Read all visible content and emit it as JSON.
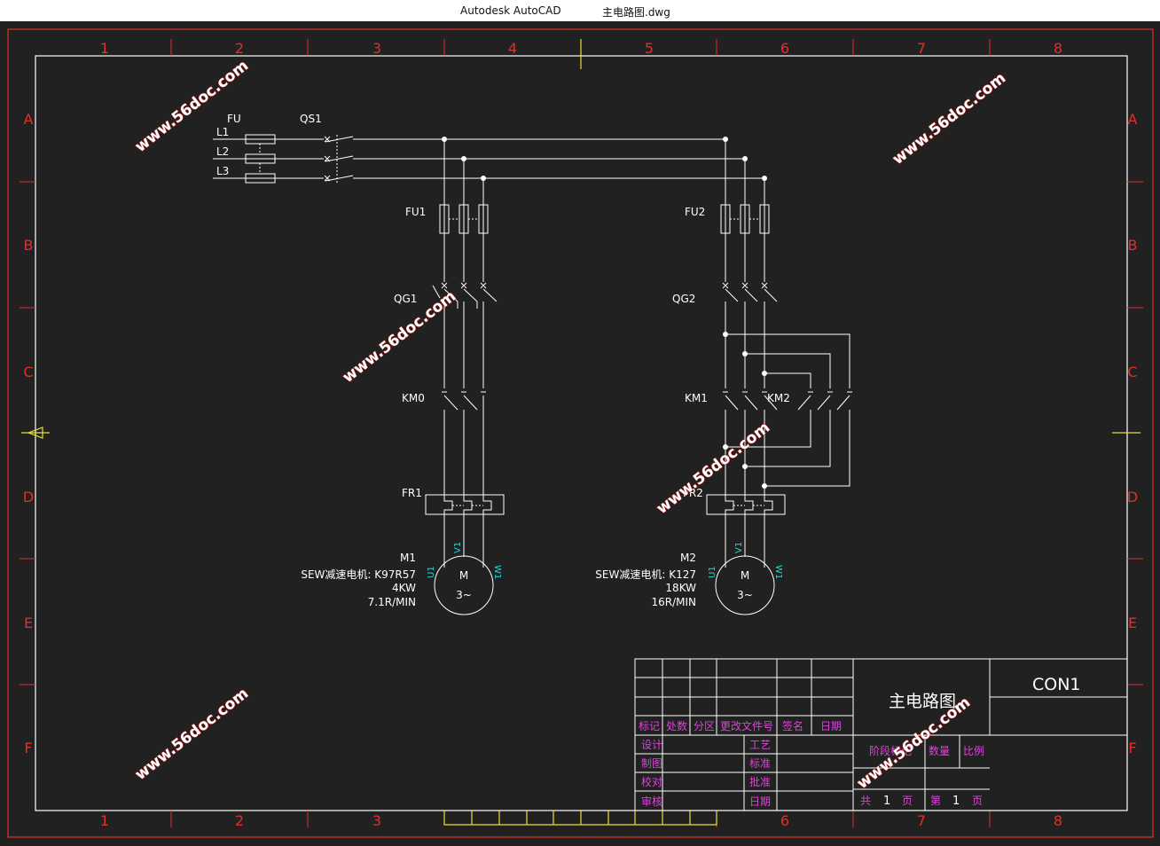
{
  "window": {
    "app_name": "Autodesk AutoCAD",
    "file_name": "主电路图.dwg"
  },
  "frame": {
    "columns": [
      "1",
      "2",
      "3",
      "4",
      "5",
      "6",
      "7",
      "8"
    ],
    "rows": [
      "A",
      "B",
      "C",
      "D",
      "E",
      "F"
    ]
  },
  "supply": {
    "fuse_label": "FU",
    "switch_label": "QS1",
    "lines": [
      "L1",
      "L2",
      "L3"
    ]
  },
  "branch1": {
    "fuse": "FU1",
    "breaker": "QG1",
    "contactor": "KM0",
    "relay": "FR1",
    "motor_tag": "M1",
    "motor_model": "SEW减速电机: K97R57",
    "power": "4KW",
    "speed": "7.1R/MIN",
    "motor_symbol": "M",
    "motor_phase": "3~",
    "terminals": [
      "U1",
      "V1",
      "W1"
    ]
  },
  "branch2": {
    "fuse": "FU2",
    "breaker": "QG2",
    "contactor1": "KM1",
    "contactor2": "KM2",
    "relay": "FR2",
    "motor_tag": "M2",
    "motor_model": "SEW减速电机: K127",
    "power": "18KW",
    "speed": "16R/MIN",
    "motor_symbol": "M",
    "motor_phase": "3~",
    "terminals": [
      "U1",
      "V1",
      "W1"
    ]
  },
  "title_block": {
    "revision_headers": [
      "标记",
      "处数",
      "分区",
      "更改文件号",
      "签名",
      "日期"
    ],
    "roles": [
      "设计",
      "制图",
      "校对",
      "审核"
    ],
    "approvals": [
      "工艺",
      "标准",
      "批准",
      "日期"
    ],
    "drawing_title": "主电路图",
    "drawing_number": "CON1",
    "stage_label": "阶段标记",
    "quantity_label": "数量",
    "scale_label": "比例",
    "sheets_total_prefix": "共",
    "sheets_total": "1",
    "sheet_unit": "页",
    "sheet_current_prefix": "第",
    "sheet_current": "1",
    "sheet_unit2": "页"
  },
  "watermark": "www.56doc.com",
  "colors": {
    "background": "#212121",
    "frame_red": "#e0302a",
    "line_white": "#ffffff",
    "magenta": "#e040e0",
    "cyan": "#20d8d8",
    "yellow": "#e8e030"
  }
}
